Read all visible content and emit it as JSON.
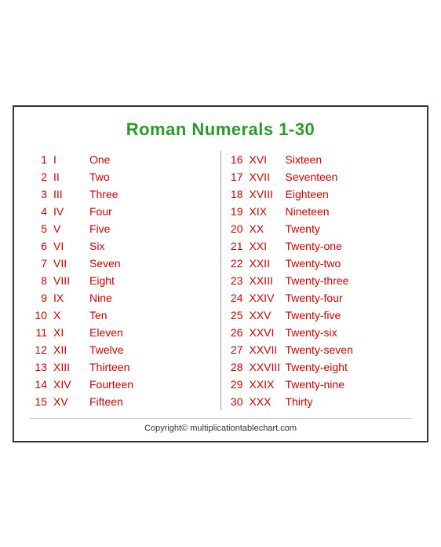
{
  "title": "Roman Numerals 1-30",
  "left": [
    {
      "num": "1",
      "roman": "I",
      "word": "One"
    },
    {
      "num": "2",
      "roman": "II",
      "word": "Two"
    },
    {
      "num": "3",
      "roman": "III",
      "word": "Three"
    },
    {
      "num": "4",
      "roman": "IV",
      "word": "Four"
    },
    {
      "num": "5",
      "roman": "V",
      "word": "Five"
    },
    {
      "num": "6",
      "roman": "VI",
      "word": "Six"
    },
    {
      "num": "7",
      "roman": "VII",
      "word": "Seven"
    },
    {
      "num": "8",
      "roman": "VIII",
      "word": "Eight"
    },
    {
      "num": "9",
      "roman": "IX",
      "word": "Nine"
    },
    {
      "num": "10",
      "roman": "X",
      "word": "Ten"
    },
    {
      "num": "11",
      "roman": "XI",
      "word": "Eleven"
    },
    {
      "num": "12",
      "roman": "XII",
      "word": "Twelve"
    },
    {
      "num": "13",
      "roman": "XIII",
      "word": "Thirteen"
    },
    {
      "num": "14",
      "roman": "XIV",
      "word": "Fourteen"
    },
    {
      "num": "15",
      "roman": "XV",
      "word": "Fifteen"
    }
  ],
  "right": [
    {
      "num": "16",
      "roman": "XVI",
      "word": "Sixteen"
    },
    {
      "num": "17",
      "roman": "XVII",
      "word": "Seventeen"
    },
    {
      "num": "18",
      "roman": "XVIII",
      "word": "Eighteen"
    },
    {
      "num": "19",
      "roman": "XIX",
      "word": "Nineteen"
    },
    {
      "num": "20",
      "roman": "XX",
      "word": "Twenty"
    },
    {
      "num": "21",
      "roman": "XXI",
      "word": "Twenty-one"
    },
    {
      "num": "22",
      "roman": "XXII",
      "word": "Twenty-two"
    },
    {
      "num": "23",
      "roman": "XXIII",
      "word": "Twenty-three"
    },
    {
      "num": "24",
      "roman": "XXIV",
      "word": "Twenty-four"
    },
    {
      "num": "25",
      "roman": "XXV",
      "word": "Twenty-five"
    },
    {
      "num": "26",
      "roman": "XXVI",
      "word": "Twenty-six"
    },
    {
      "num": "27",
      "roman": "XXVII",
      "word": "Twenty-seven"
    },
    {
      "num": "28",
      "roman": "XXVIII",
      "word": "Twenty-eight"
    },
    {
      "num": "29",
      "roman": "XXIX",
      "word": "Twenty-nine"
    },
    {
      "num": "30",
      "roman": "XXX",
      "word": "Thirty"
    }
  ],
  "copyright": "Copyright© multiplicationtablechart.com"
}
